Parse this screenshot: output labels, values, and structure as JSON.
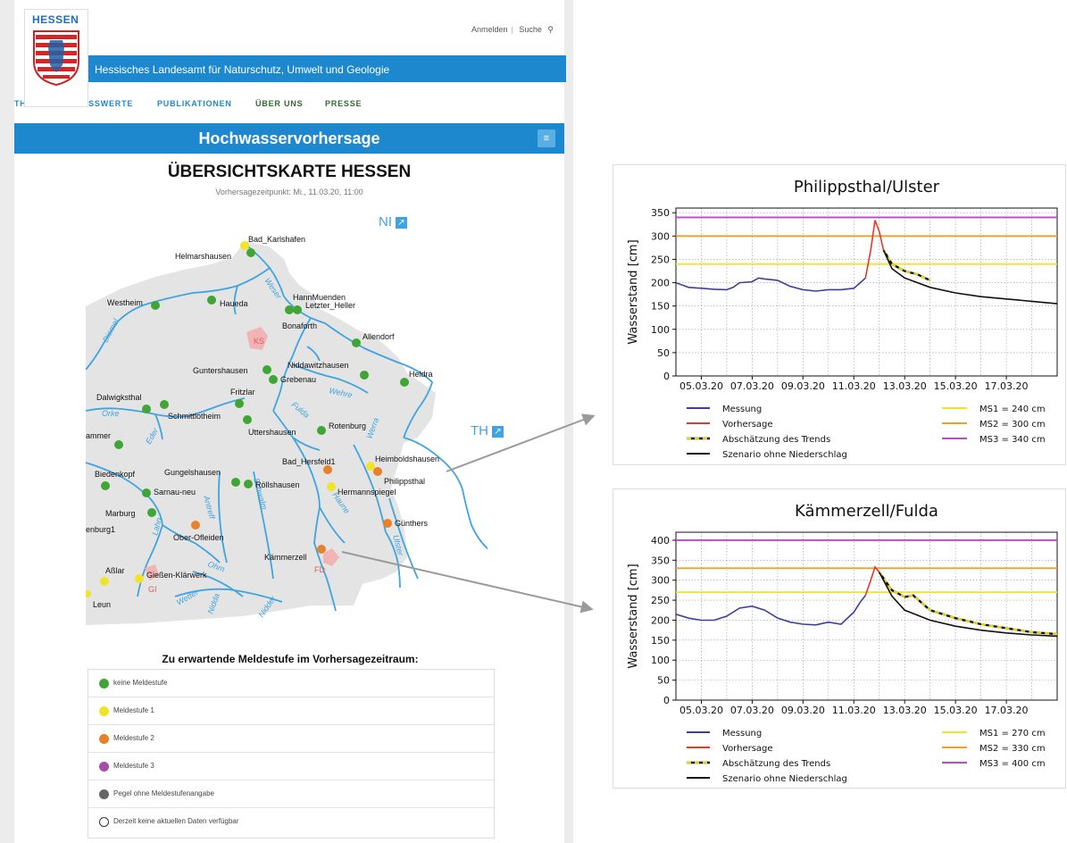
{
  "colors": {
    "blue": "#1e88cf",
    "river": "#3fa4e0",
    "green": "#3fa635",
    "yellow": "#f2e22a",
    "orange": "#e8812a",
    "purple": "#a64ca6",
    "grey": "#666666"
  },
  "site": {
    "logo_word": "HESSEN",
    "org_name": "Hessisches Landesamt für Naturschutz, Umwelt und Geologie",
    "toplinks": {
      "login": "Anmelden",
      "search": "Suche"
    },
    "nav": [
      "THEMEN",
      "MESSWERTE",
      "PUBLIKATIONEN",
      "ÜBER UNS",
      "PRESSE"
    ],
    "page_heading": "Hochwasservorhersage",
    "map_title": "ÜBERSICHTSKARTE HESSEN",
    "forecast_time": "Vorhersagezeitpunkt: Mi., 11.03.20, 11:00"
  },
  "map": {
    "external_links": [
      {
        "label": "NI"
      },
      {
        "label": "TH"
      }
    ],
    "cities": [
      "KS",
      "FD",
      "GI"
    ],
    "rivers": [
      "Weser",
      "Diemel",
      "Wehre",
      "Fulda",
      "Werra",
      "Orke",
      "Eder",
      "Antreff",
      "Schwalm",
      "Haune",
      "Ulster",
      "Ohm",
      "Lahn",
      "Wetter",
      "Nidda",
      "Nidder"
    ],
    "stations": [
      {
        "name": "Bad_Karlshafen",
        "level": "yellow"
      },
      {
        "name": "Helmarshausen",
        "level": "green"
      },
      {
        "name": "Westheim",
        "level": "green"
      },
      {
        "name": "Haueda",
        "level": "green"
      },
      {
        "name": "HannMuenden",
        "level": "green"
      },
      {
        "name": "Letzter_Heller",
        "level": "green"
      },
      {
        "name": "Bonaforth",
        "level": "green"
      },
      {
        "name": "Allendorf",
        "level": "green"
      },
      {
        "name": "Guntershausen",
        "level": "green"
      },
      {
        "name": "Grebenau",
        "level": "green"
      },
      {
        "name": "Niddawitzhausen",
        "level": "green"
      },
      {
        "name": "Heldra",
        "level": "green"
      },
      {
        "name": "Dalwigksthal",
        "level": "green"
      },
      {
        "name": "Schmittlotheim",
        "level": "green"
      },
      {
        "name": "Fritzlar",
        "level": "green"
      },
      {
        "name": "Uttershausen",
        "level": "green"
      },
      {
        "name": "Rotenburg",
        "level": "green"
      },
      {
        "name": "ammer",
        "level": "green"
      },
      {
        "name": "Heimboldshausen",
        "level": "yellow"
      },
      {
        "name": "Philippsthal",
        "level": "orange"
      },
      {
        "name": "Bad_Hersfeld1",
        "level": "orange"
      },
      {
        "name": "Hermannspiegel",
        "level": "yellow"
      },
      {
        "name": "Biedenkopf",
        "level": "green"
      },
      {
        "name": "Gungelshausen",
        "level": "green"
      },
      {
        "name": "Röllshausen",
        "level": "green"
      },
      {
        "name": "Sarnau-neu",
        "level": "green"
      },
      {
        "name": "Marburg",
        "level": "green"
      },
      {
        "name": "Günthers",
        "level": "orange"
      },
      {
        "name": "enburg1",
        "level": "none"
      },
      {
        "name": "Ober-Ofleiden",
        "level": "orange"
      },
      {
        "name": "Kämmerzell",
        "level": "orange"
      },
      {
        "name": "Aßlar",
        "level": "yellow"
      },
      {
        "name": "Gießen-Klärwerk",
        "level": "yellow"
      },
      {
        "name": "Leun",
        "level": "yellow"
      }
    ]
  },
  "legend": {
    "title": "Zu erwartende Meldestufe im Vorhersagezeitraum:",
    "items": [
      {
        "label": "keine Meldestufe",
        "color": "#3fa635"
      },
      {
        "label": "Meldestufe 1",
        "color": "#f2e22a"
      },
      {
        "label": "Meldestufe 2",
        "color": "#e8812a"
      },
      {
        "label": "Meldestufe 3",
        "color": "#a64ca6"
      },
      {
        "label": "Pegel ohne Meldestufenangabe",
        "color": "#666666"
      },
      {
        "label": "Derzeit keine aktuellen Daten verfügbar",
        "color": "none"
      }
    ]
  },
  "chart_data": [
    {
      "type": "line",
      "title": "Philippsthal/Ulster",
      "xlabel": "",
      "ylabel": "Wasserstand [cm]",
      "xlim": [
        "04.03.20",
        "19.03.20"
      ],
      "ylim": [
        0,
        360
      ],
      "xticks": [
        "05.03.20",
        "07.03.20",
        "09.03.20",
        "11.03.20",
        "13.03.20",
        "15.03.20",
        "17.03.20"
      ],
      "yticks": [
        0,
        50,
        100,
        150,
        200,
        250,
        300,
        350
      ],
      "grid": true,
      "thresholds": [
        {
          "name": "MS1 = 240 cm",
          "value": 240,
          "color": "#f2e22a"
        },
        {
          "name": "MS2 = 300 cm",
          "value": 300,
          "color": "#f0a020"
        },
        {
          "name": "MS3 = 340 cm",
          "value": 340,
          "color": "#b84cc4"
        }
      ],
      "series": [
        {
          "name": "Messung",
          "color": "#3a3fa0",
          "style": "solid",
          "x": [
            "04.03.20 00:00",
            "04.03.20 12:00",
            "05.03.20 00:00",
            "05.03.20 12:00",
            "06.03.20 00:00",
            "06.03.20 06:00",
            "06.03.20 12:00",
            "07.03.20 00:00",
            "07.03.20 06:00",
            "07.03.20 12:00",
            "08.03.20 00:00",
            "08.03.20 12:00",
            "09.03.20 00:00",
            "09.03.20 12:00",
            "10.03.20 00:00",
            "10.03.20 12:00",
            "11.03.20 00:00",
            "11.03.20 06:00",
            "11.03.20 11:00"
          ],
          "y": [
            200,
            190,
            188,
            186,
            185,
            190,
            200,
            202,
            210,
            208,
            205,
            192,
            185,
            182,
            185,
            185,
            188,
            200,
            210
          ]
        },
        {
          "name": "Vorhersage",
          "color": "#e03a2a",
          "style": "solid",
          "x": [
            "11.03.20 11:00",
            "11.03.20 16:00",
            "11.03.20 20:00",
            "12.03.20 00:00",
            "12.03.20 04:00"
          ],
          "y": [
            210,
            270,
            334,
            310,
            270
          ]
        },
        {
          "name": "Abschätzung des Trends",
          "color": "#e8d21a",
          "style": "dashed",
          "x": [
            "12.03.20 04:00",
            "12.03.20 12:00",
            "13.03.20 00:00",
            "13.03.20 12:00",
            "14.03.20 00:00"
          ],
          "y": [
            270,
            240,
            225,
            218,
            205
          ]
        },
        {
          "name": "Szenario ohne Niederschlag",
          "color": "#111111",
          "style": "solid",
          "x": [
            "12.03.20 04:00",
            "12.03.20 12:00",
            "13.03.20 00:00",
            "14.03.20 00:00",
            "15.03.20 00:00",
            "16.03.20 00:00",
            "17.03.20 00:00",
            "18.03.20 00:00",
            "19.03.20 00:00"
          ],
          "y": [
            270,
            230,
            210,
            190,
            178,
            170,
            165,
            160,
            155
          ]
        }
      ]
    },
    {
      "type": "line",
      "title": "Kämmerzell/Fulda",
      "xlabel": "",
      "ylabel": "Wasserstand [cm]",
      "xlim": [
        "04.03.20",
        "19.03.20"
      ],
      "ylim": [
        0,
        420
      ],
      "xticks": [
        "05.03.20",
        "07.03.20",
        "09.03.20",
        "11.03.20",
        "13.03.20",
        "15.03.20",
        "17.03.20"
      ],
      "yticks": [
        0,
        50,
        100,
        150,
        200,
        250,
        300,
        350,
        400
      ],
      "grid": true,
      "thresholds": [
        {
          "name": "MS1 = 270 cm",
          "value": 270,
          "color": "#f2e22a"
        },
        {
          "name": "MS2 = 330 cm",
          "value": 330,
          "color": "#f0a020"
        },
        {
          "name": "MS3 = 400 cm",
          "value": 400,
          "color": "#b84cc4"
        }
      ],
      "series": [
        {
          "name": "Messung",
          "color": "#3a3fa0",
          "style": "solid",
          "x": [
            "04.03.20 00:00",
            "04.03.20 12:00",
            "05.03.20 00:00",
            "05.03.20 12:00",
            "06.03.20 00:00",
            "06.03.20 12:00",
            "07.03.20 00:00",
            "07.03.20 12:00",
            "08.03.20 00:00",
            "08.03.20 12:00",
            "09.03.20 00:00",
            "09.03.20 12:00",
            "10.03.20 00:00",
            "10.03.20 12:00",
            "11.03.20 00:00",
            "11.03.20 06:00",
            "11.03.20 11:00"
          ],
          "y": [
            215,
            205,
            200,
            200,
            210,
            230,
            235,
            225,
            205,
            195,
            190,
            188,
            195,
            190,
            220,
            245,
            262
          ]
        },
        {
          "name": "Vorhersage",
          "color": "#e03a2a",
          "style": "solid",
          "x": [
            "11.03.20 11:00",
            "11.03.20 16:00",
            "11.03.20 20:00",
            "12.03.20 00:00"
          ],
          "y": [
            262,
            300,
            333,
            320
          ]
        },
        {
          "name": "Abschätzung des Trends",
          "color": "#e8d21a",
          "style": "dashed",
          "x": [
            "12.03.20 00:00",
            "12.03.20 12:00",
            "13.03.20 00:00",
            "13.03.20 08:00",
            "14.03.20 00:00",
            "15.03.20 00:00",
            "16.03.20 00:00",
            "17.03.20 00:00",
            "18.03.20 00:00",
            "19.03.20 00:00"
          ],
          "y": [
            320,
            275,
            258,
            262,
            225,
            205,
            190,
            180,
            170,
            165
          ]
        },
        {
          "name": "Szenario ohne Niederschlag",
          "color": "#111111",
          "style": "solid",
          "x": [
            "12.03.20 00:00",
            "12.03.20 12:00",
            "13.03.20 00:00",
            "14.03.20 00:00",
            "15.03.20 00:00",
            "16.03.20 00:00",
            "17.03.20 00:00",
            "18.03.20 00:00",
            "19.03.20 00:00"
          ],
          "y": [
            320,
            260,
            225,
            200,
            185,
            175,
            168,
            163,
            160
          ]
        }
      ]
    }
  ]
}
